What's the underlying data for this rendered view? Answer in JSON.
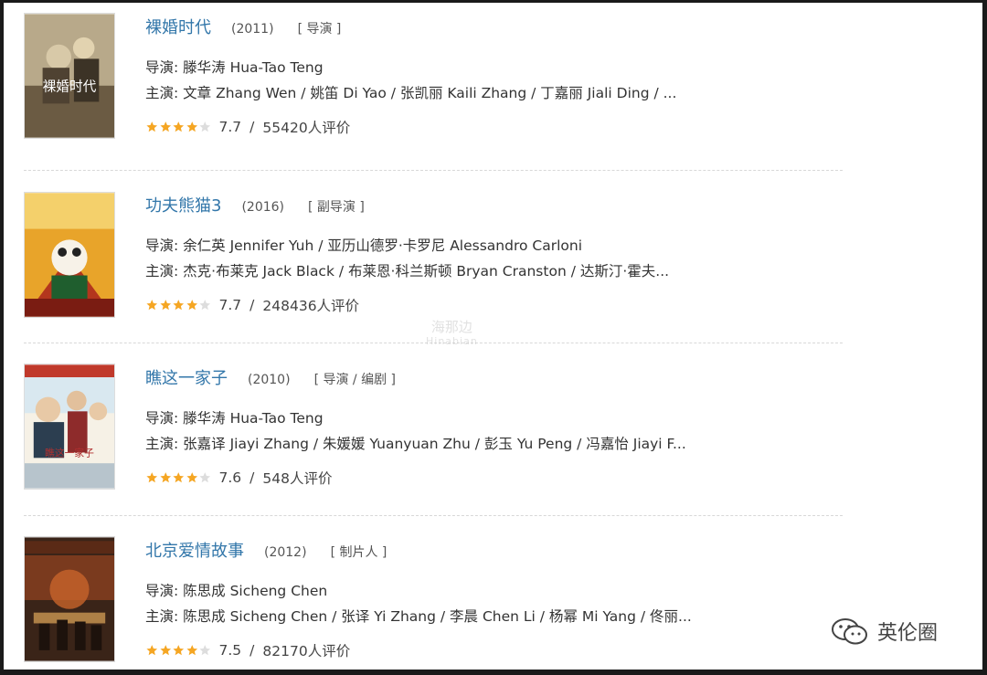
{
  "movies": [
    {
      "title": "裸婚时代",
      "year": "(2011)",
      "role": "[ 导演 ]",
      "director_line": "导演: 滕华涛 Hua-Tao Teng",
      "cast_line": "主演: 文章 Zhang Wen / 姚笛 Di Yao / 张凯丽 Kaili Zhang / 丁嘉丽 Jiali Ding / ...",
      "stars": 4,
      "score": "7.7",
      "separator": "/",
      "reviews": "55420人评价",
      "poster_text": "裸婚时代",
      "poster_colors": [
        "#b8a98a",
        "#6b5b43",
        "#d8c9a8"
      ]
    },
    {
      "title": "功夫熊猫3",
      "year": "(2016)",
      "role": "[ 副导演 ]",
      "director_line": "导演: 余仁英 Jennifer Yuh / 亚历山德罗·卡罗尼 Alessandro Carloni",
      "cast_line": "主演: 杰克·布莱克 Jack Black / 布莱恩·科兰斯顿 Bryan Cranston / 达斯汀·霍夫...",
      "stars": 4,
      "score": "7.7",
      "separator": "/",
      "reviews": "248436人评价",
      "poster_text": "",
      "poster_colors": [
        "#e8a42a",
        "#b3361d",
        "#f4d06b"
      ]
    },
    {
      "title": "瞧这一家子",
      "year": "(2010)",
      "role": "[ 导演 / 编剧 ]",
      "director_line": "导演: 滕华涛 Hua-Tao Teng",
      "cast_line": "主演: 张嘉译 Jiayi Zhang / 朱媛媛 Yuanyuan Zhu / 彭玉 Yu Peng / 冯嘉怡 Jiayi F...",
      "stars": 4,
      "score": "7.6",
      "separator": "/",
      "reviews": "548人评价",
      "poster_text": "瞧这一家子",
      "poster_colors": [
        "#d9e8f0",
        "#c0392b",
        "#f6f1e6"
      ]
    },
    {
      "title": "北京爱情故事",
      "year": "(2012)",
      "role": "[ 制片人 ]",
      "director_line": "导演: 陈思成 Sicheng Chen",
      "cast_line": "主演: 陈思成 Sicheng Chen / 张译 Yi Zhang / 李晨 Chen Li / 杨幂 Mi Yang / 佟丽...",
      "stars": 4,
      "score": "7.5",
      "separator": "/",
      "reviews": "82170人评价",
      "poster_text": "",
      "poster_colors": [
        "#3a2418",
        "#c8642a",
        "#7a3a1e"
      ]
    }
  ],
  "watermark": {
    "center_main": "海那边",
    "center_sub": "Hinabian",
    "brand": "英伦圈"
  },
  "colors": {
    "title": "#3377aa",
    "star_on": "#f5a623",
    "star_off": "#dddddd",
    "divider": "#d8d8d8"
  },
  "icons": {
    "star": "star-icon",
    "brand_logo": "wechat-icon"
  }
}
